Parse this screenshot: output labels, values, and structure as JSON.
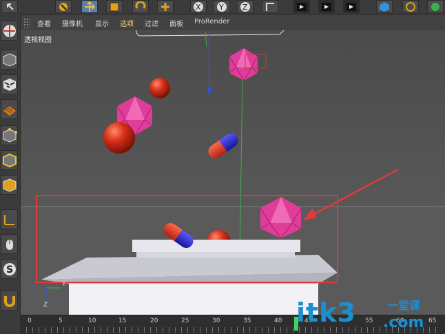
{
  "menubar": {
    "items": [
      "查看",
      "摄像机",
      "显示",
      "选项",
      "过滤",
      "面板",
      "ProRender"
    ],
    "active_index": 3
  },
  "viewport": {
    "label": "透视视图",
    "axis_labels": {
      "y": "Y",
      "z": "Z"
    }
  },
  "timeline": {
    "ticks": [
      "0",
      "5",
      "10",
      "15",
      "20",
      "25",
      "30",
      "35",
      "40",
      "45",
      "55",
      "60",
      "65"
    ],
    "current_frame_indicator": "green-marker"
  },
  "watermark": {
    "main": "itk3",
    "top": "一堂课",
    "bottom": ".com"
  },
  "colors": {
    "accent_active_menu": "#f0d870",
    "annotation_red": "#e03a3a",
    "primitive_magenta": "#e03c9a",
    "sphere_red": "#d8301a",
    "capsule_blue": "#2b2bd0",
    "watermark_blue": "#1c8fd1"
  },
  "icons": {
    "top_toolbar": [
      "undo-icon",
      "move-icon",
      "scale-icon",
      "rotate-icon",
      "live-select-icon",
      "axis-x-icon",
      "axis-y-icon",
      "axis-z-icon",
      "coordinate-system-icon",
      "render-view-icon",
      "render-picture-viewer-icon",
      "render-settings-icon",
      "cube-icon",
      "deformer-icon",
      "scene-icon"
    ],
    "left_toolbar": [
      "model-icon",
      "object-mode-icon",
      "texture-icon",
      "workplane-icon",
      "points-icon",
      "edges-icon",
      "polygons-icon",
      "axis-icon",
      "tweak-icon",
      "snap-icon",
      "magnet-icon"
    ]
  }
}
